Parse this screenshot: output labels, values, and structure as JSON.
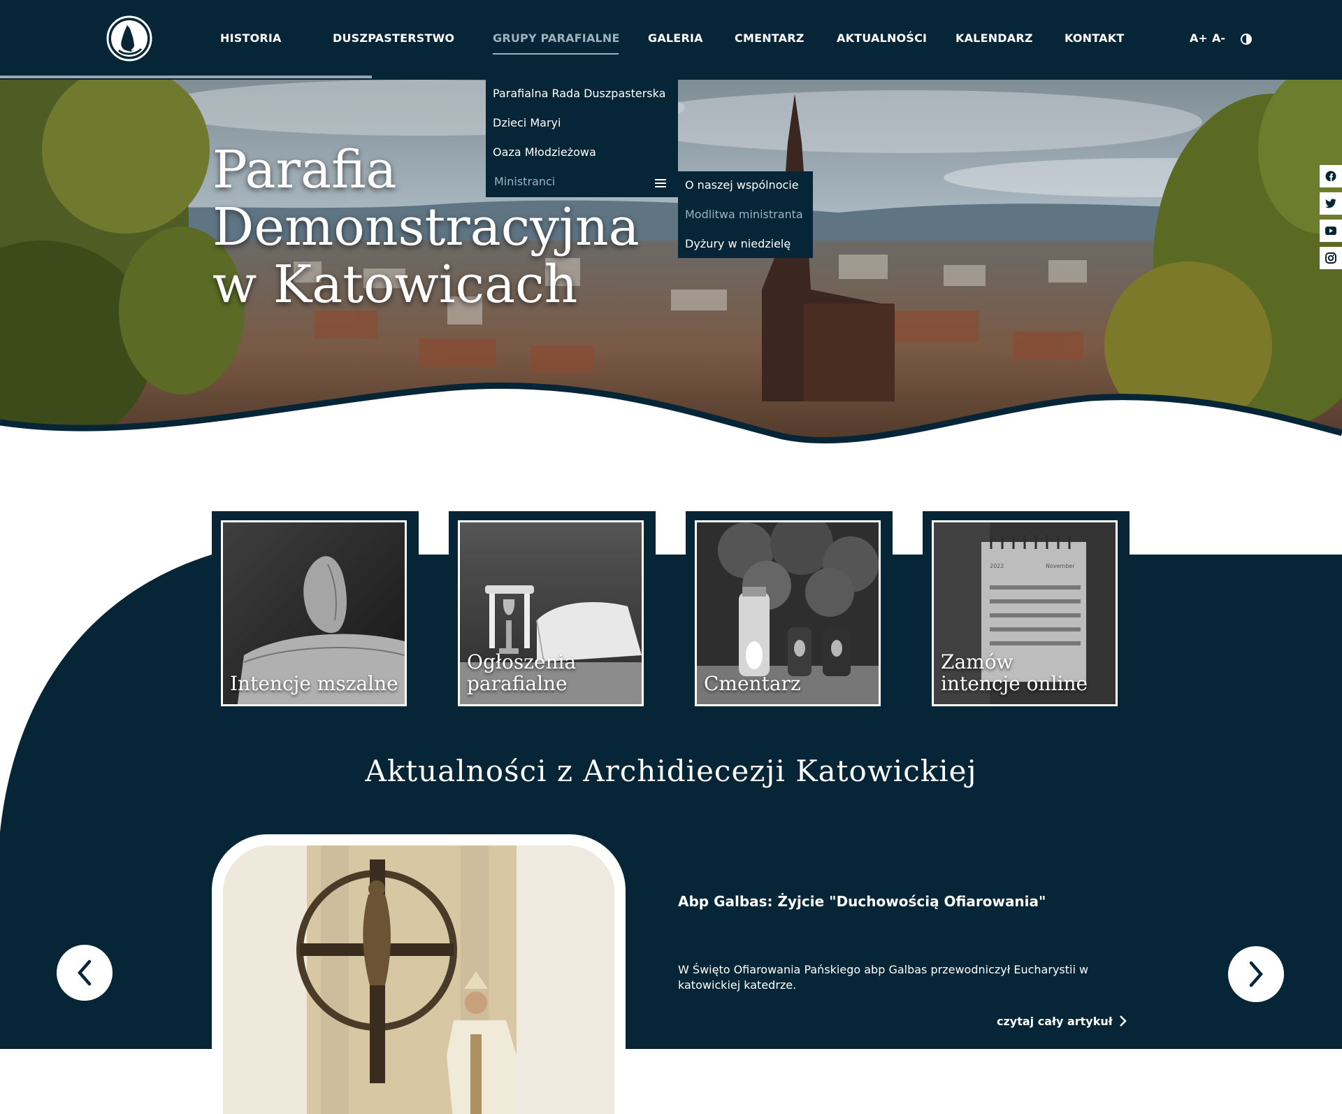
{
  "header": {
    "logo_alt": "praying-hands-logo",
    "nav": [
      {
        "label": "HISTORIA"
      },
      {
        "label": "DUSZPASTERSTWO"
      },
      {
        "label": "GRUPY PARAFIALNE",
        "active": true
      },
      {
        "label": "GALERIA"
      },
      {
        "label": "CMENTARZ"
      },
      {
        "label": "AKTUALNOŚCI"
      },
      {
        "label": "KALENDARZ"
      },
      {
        "label": "KONTAKT"
      }
    ],
    "font_increase": "A+",
    "font_decrease": "A-",
    "contrast_icon": "contrast-icon",
    "scroll_progress": 0.277
  },
  "dropdown": {
    "items": [
      "Parafialna Rada Duszpasterska",
      "Dzieci Maryi",
      "Oaza Młodzieżowa",
      "Ministranci"
    ],
    "submenu": [
      "O naszej wspólnocie",
      "Modlitwa ministranta",
      "Dyżury w niedzielę"
    ]
  },
  "hero": {
    "title_lines": [
      "Parafia",
      "Demonstracyjna",
      "w Katowicach"
    ]
  },
  "social": [
    "facebook-icon",
    "twitter-icon",
    "youtube-icon",
    "instagram-icon"
  ],
  "tiles": [
    {
      "label_lines": [
        "Intencje mszalne"
      ]
    },
    {
      "label_lines": [
        "Ogłoszenia",
        "parafialne"
      ]
    },
    {
      "label_lines": [
        "Cmentarz"
      ]
    },
    {
      "label_lines": [
        "Zamów",
        "intencje online"
      ]
    }
  ],
  "calendar": {
    "year": "2022",
    "month": "November"
  },
  "news": {
    "section_title": "Aktualności z Archidiecezji Katowickiej",
    "title": "Abp Galbas: Żyjcie \"Duchowością Ofiarowania\"",
    "text": "W Święto Ofiarowania Pańskiego abp Galbas przewodniczył Eucharystii w katowickiej katedrze.",
    "read_more": "czytaj cały artykuł"
  },
  "colors": {
    "primary": "#062637",
    "muted": "#9db2be",
    "white": "#ffffff"
  }
}
